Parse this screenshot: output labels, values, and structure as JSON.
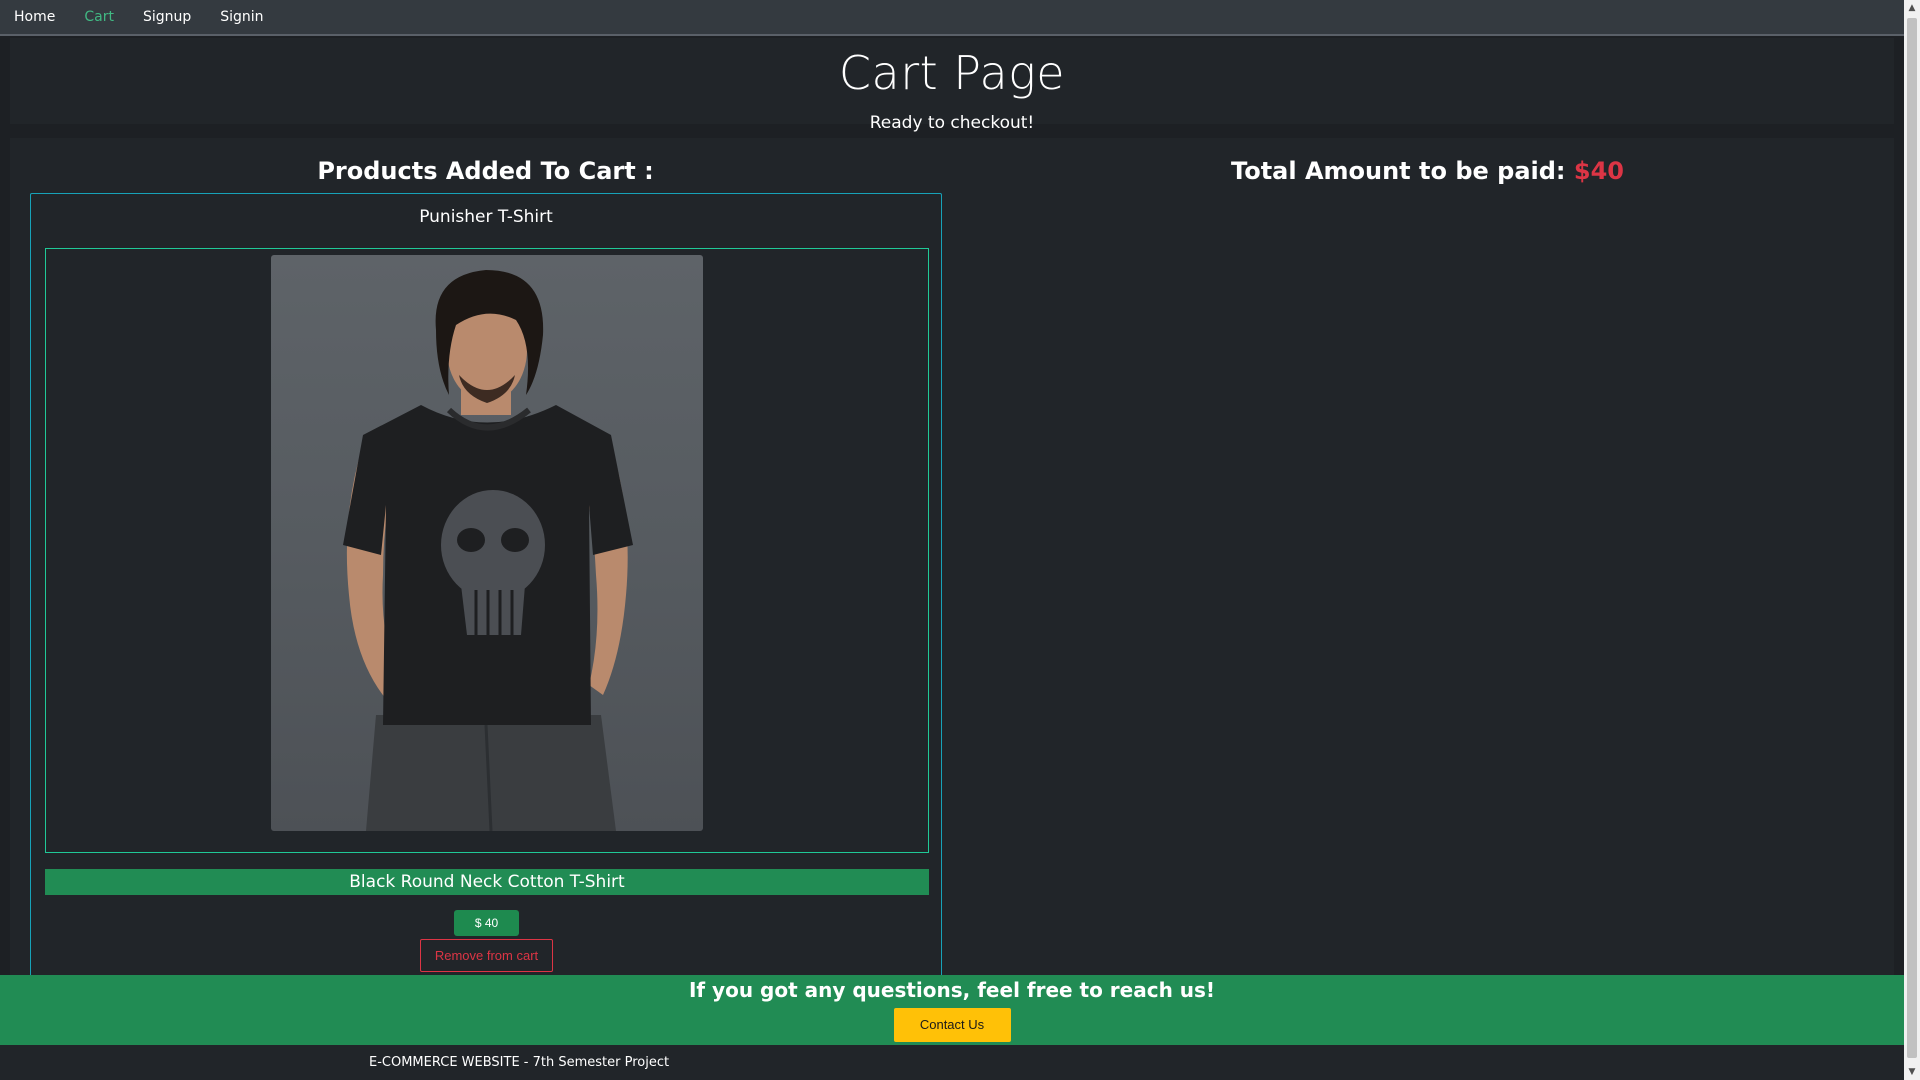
{
  "nav": {
    "items": [
      "Home",
      "Cart",
      "Signup",
      "Signin"
    ],
    "active": "Cart"
  },
  "header": {
    "title": "Cart Page",
    "subtitle": "Ready to checkout!"
  },
  "cart": {
    "heading": "Products Added To Cart :",
    "product": {
      "name": "Punisher T-Shirt",
      "description": "Black Round Neck Cotton T-Shirt",
      "price_label": "$ 40",
      "remove_label": "Remove from cart"
    }
  },
  "total": {
    "label": "Total Amount to be paid:",
    "amount": "$40"
  },
  "cta": {
    "heading": "If you got any questions, feel free to reach us!",
    "button_label": "Contact Us"
  },
  "footer": {
    "text": "E-COMMERCE WEBSITE - 7th Semester Project"
  },
  "colors": {
    "accent_green": "#218c54",
    "active_link": "#41b883",
    "danger": "#dc3545",
    "warning": "#ffc107",
    "card_border": "#17a2b8"
  }
}
